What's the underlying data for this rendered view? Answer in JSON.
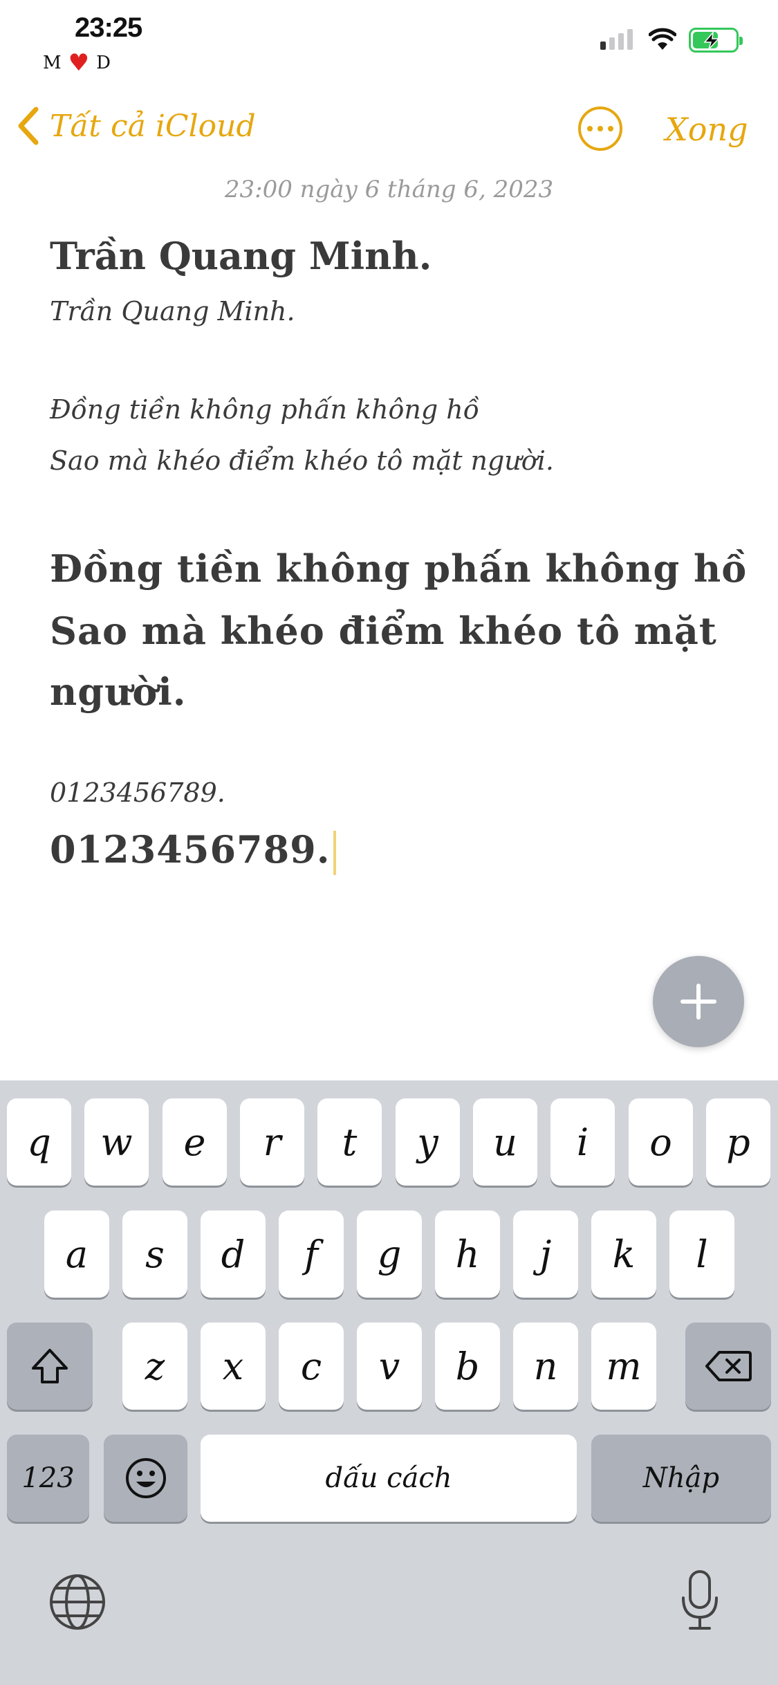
{
  "status_bar": {
    "time": "23:25",
    "carrier_tag_left": "M",
    "carrier_tag_right": "D",
    "heart": "♥",
    "icons": [
      "signal-icon",
      "wifi-icon",
      "battery-charging-icon"
    ]
  },
  "nav": {
    "back_label": "Tất cả iCloud",
    "done_label": "Xong",
    "more_icon": "ellipsis-circle-icon"
  },
  "note": {
    "date": "23:00 ngày 6 tháng 6, 2023",
    "title": "Trần Quang Minh.",
    "line_subtitle": "Trần Quang Minh.",
    "small_poem": [
      "Đồng tiền không phấn không hồ",
      "Sao mà khéo điểm khéo tô mặt người."
    ],
    "large_poem": [
      "Đồng tiền không phấn không hồ",
      "Sao mà khéo điểm khéo tô mặt",
      "người."
    ],
    "digits_small": "0123456789.",
    "digits_large": "0123456789."
  },
  "fab": {
    "icon": "plus-icon"
  },
  "keyboard": {
    "row1": [
      "q",
      "w",
      "e",
      "r",
      "t",
      "y",
      "u",
      "i",
      "o",
      "p"
    ],
    "row2": [
      "a",
      "s",
      "d",
      "f",
      "g",
      "h",
      "j",
      "k",
      "l"
    ],
    "row3": [
      "z",
      "x",
      "c",
      "v",
      "b",
      "n",
      "m"
    ],
    "numbers_label": "123",
    "space_label": "dấu cách",
    "return_label": "Nhập",
    "icons": [
      "shift-icon",
      "backspace-icon",
      "emoji-icon",
      "globe-icon",
      "microphone-icon"
    ]
  },
  "colors": {
    "accent": "#e6a70f",
    "keyboard_bg": "#d1d4d9",
    "key_dark": "#acb1ba",
    "fab": "#a9adb6",
    "battery": "#34c759"
  }
}
